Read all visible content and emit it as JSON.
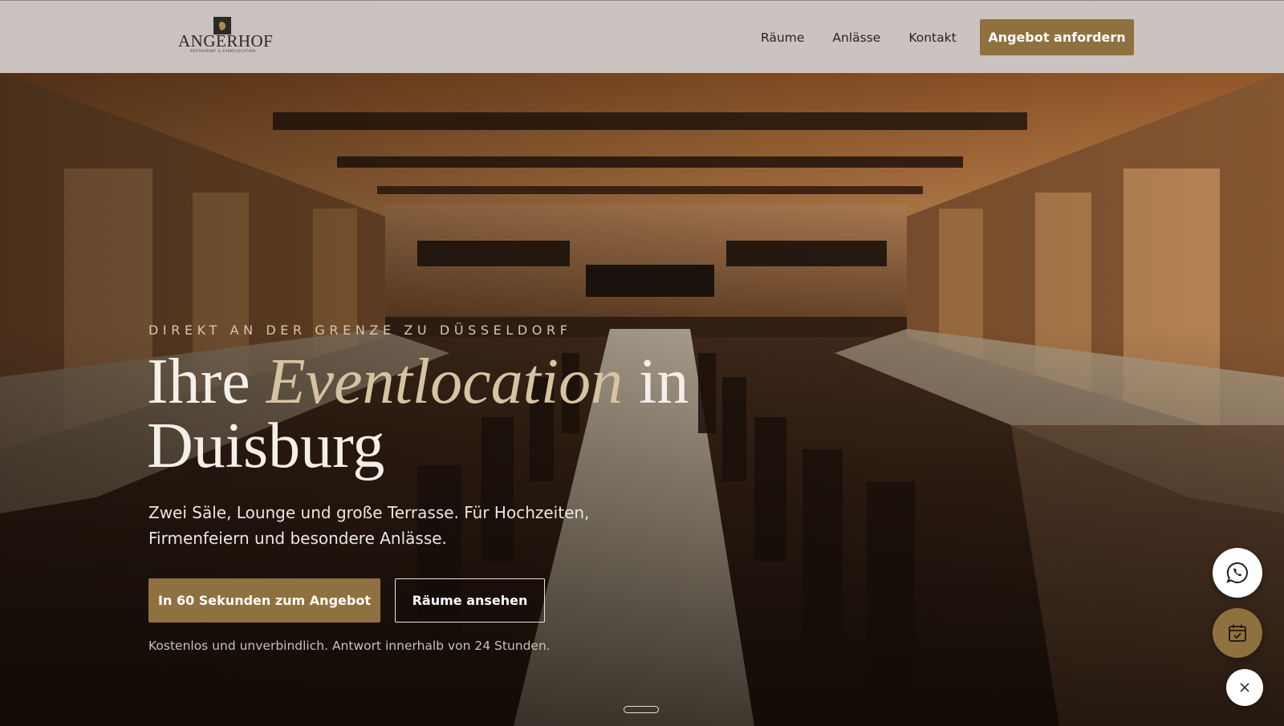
{
  "brand": {
    "logo_text": "ANGERHOF",
    "logo_subtext": "RESTAURANT & EVENTLOCATION"
  },
  "nav": {
    "items": [
      {
        "label": "Räume"
      },
      {
        "label": "Anlässe"
      },
      {
        "label": "Kontakt"
      }
    ],
    "cta_label": "Angebot anfordern"
  },
  "hero": {
    "eyebrow": "DIREKT AN DER GRENZE ZU DÜSSELDORF",
    "headline_part1": "Ihre ",
    "headline_accent": "Eventlocation",
    "headline_part2": " in Duisburg",
    "subline": "Zwei Säle, Lounge und große Terrasse. Für Hochzeiten, Firmenfeiern und besondere Anlässe.",
    "primary_button": "In 60 Sekunden zum Angebot",
    "secondary_button": "Räume ansehen",
    "note": "Kostenlos und unverbindlich. Antwort innerhalb von 24 Stunden."
  },
  "floating_actions": {
    "whatsapp_icon": "whatsapp-icon",
    "calendar_icon": "calendar-check-icon",
    "close_icon": "close-icon"
  },
  "colors": {
    "accent": "#8f7140",
    "header_bg": "#d6d0cc",
    "headline_accent": "#d6c3a1",
    "text_light": "#f4efe8"
  }
}
